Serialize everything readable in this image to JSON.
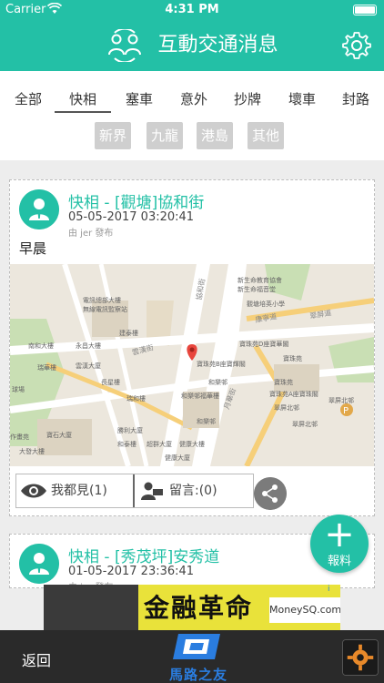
{
  "status_bar": {
    "carrier": "Carrier",
    "time": "4:31 PM"
  },
  "header": {
    "title": "互動交通消息"
  },
  "tabs": [
    "全部",
    "快相",
    "塞車",
    "意外",
    "抄牌",
    "壞車",
    "封路"
  ],
  "active_tab": "快相",
  "subtabs": [
    "新界",
    "九龍",
    "港島",
    "其他"
  ],
  "posts": [
    {
      "title": "快相 - [觀塘]協和街",
      "date": "05-05-2017 03:20:41",
      "author": "由 jer 發布",
      "body": "早晨",
      "seen_label": "我都見(1)",
      "comment_label": "留言:(0)"
    },
    {
      "title": "快相 - [秀茂坪]安秀道",
      "date": "01-05-2017 23:36:41",
      "author": "由 jer 發布"
    }
  ],
  "map": {
    "labels": [
      "電訊總部大樓",
      "無線電訊監察站",
      "新生命教育協會",
      "新生命福音堂",
      "觀塘培英小學",
      "寶珠苑D座寶華閣",
      "寶珠苑",
      "寶珠苑",
      "寶珠苑B座寶輝閣",
      "寶珠苑E座寶輝閣",
      "寶珠苑",
      "寶珠苑A座寶珠閣",
      "翠屏北邨",
      "翠屏北邨",
      "和樂邨",
      "和樂邨",
      "和樂邨",
      "翠屏北邨",
      "雲漢大廈",
      "南和大樓",
      "永昌大樓",
      "建泰樓",
      "瑞華樓",
      "雲漢大廈",
      "長星樓",
      "瑞和樓",
      "秀茂坪大樓",
      "協和街",
      "康寧道",
      "月華街",
      "球場",
      "作畫苑",
      "勝利大廈",
      "寶石大廈",
      "大發大樓",
      "和泰樓",
      "超群大廈",
      "健康大廈",
      "健康大樓"
    ],
    "streets": [
      "協和街",
      "雲漢街",
      "月華街",
      "康寧道",
      "開源道",
      "翠屏道",
      "寶珠道"
    ]
  },
  "fab": {
    "plus": "+",
    "label": "報料"
  },
  "ad": {
    "headline": "金融革命",
    "brand": "MoneySQ.com",
    "info": "i"
  },
  "bottom_bar": {
    "back_label": "返回",
    "logo_text": "馬路之友"
  },
  "colors": {
    "accent": "#23c0a6",
    "dark_bar": "#2a2a2a"
  }
}
